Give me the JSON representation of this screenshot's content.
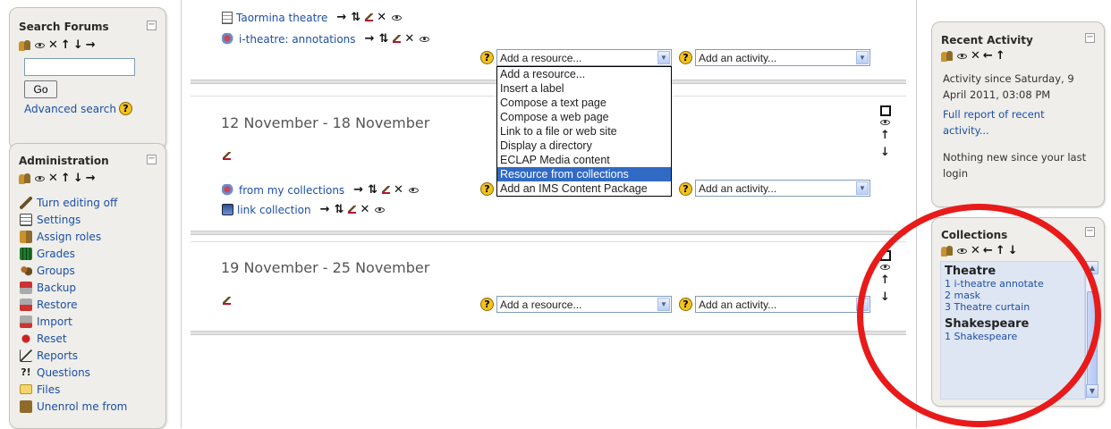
{
  "search_forums": {
    "title": "Search Forums",
    "input_value": "",
    "go_label": "Go",
    "advanced_label": "Advanced search"
  },
  "administration": {
    "title": "Administration",
    "items": [
      {
        "label": "Turn editing off",
        "icon": "pencil-icon"
      },
      {
        "label": "Settings",
        "icon": "settings-icon"
      },
      {
        "label": "Assign roles",
        "icon": "roles-icon"
      },
      {
        "label": "Grades",
        "icon": "grades-icon"
      },
      {
        "label": "Groups",
        "icon": "groups-icon"
      },
      {
        "label": "Backup",
        "icon": "backup-icon"
      },
      {
        "label": "Restore",
        "icon": "restore-icon"
      },
      {
        "label": "Import",
        "icon": "import-icon"
      },
      {
        "label": "Reset",
        "icon": "reset-icon"
      },
      {
        "label": "Reports",
        "icon": "reports-icon"
      },
      {
        "label": "Questions",
        "icon": "questions-icon"
      },
      {
        "label": "Files",
        "icon": "folder-icon"
      },
      {
        "label": "Unenrol me from",
        "icon": "unenrol-icon"
      }
    ]
  },
  "week_top": {
    "activities": [
      {
        "label": "Taormina theatre",
        "icon": "page-icon"
      },
      {
        "label": "i-theatre: annotations",
        "icon": "annotation-icon"
      }
    ],
    "resource_select": "Add a resource...",
    "activity_select": "Add an activity..."
  },
  "resource_dropdown": {
    "options": [
      "Add a resource...",
      "Insert a label",
      "Compose a text page",
      "Compose a web page",
      "Link to a file or web site",
      "Display a directory",
      "ECLAP Media content",
      "Resource from collections",
      "Add an IMS Content Package"
    ],
    "highlighted": "Resource from collections"
  },
  "week_2": {
    "title": "12 November - 18 November",
    "activities": [
      {
        "label": "from my collections",
        "icon": "annotation-icon"
      },
      {
        "label": "link collection",
        "icon": "collection-icon"
      }
    ],
    "resource_select": "Add a resource...",
    "activity_select": "Add an activity..."
  },
  "week_3": {
    "title": "19 November - 25 November",
    "resource_select": "Add a resource...",
    "activity_select": "Add an activity..."
  },
  "recent_activity": {
    "title": "Recent Activity",
    "since_text": "Activity since Saturday, 9 April 2011, 03:08 PM",
    "full_report": "Full report of recent activity...",
    "nothing_new": "Nothing new since your last login"
  },
  "collections": {
    "title": "Collections",
    "groups": [
      {
        "name": "Theatre",
        "items": [
          "1 i-theatre annotate",
          "2 mask",
          "3 Theatre curtain"
        ]
      },
      {
        "name": "Shakespeare",
        "items": [
          "1 Shakespeare"
        ]
      }
    ]
  },
  "colors": {
    "link": "#1c4fa8",
    "highlight": "#316ac5",
    "annotation_circle": "#e81a1a",
    "block_bg": "#efeeea"
  }
}
